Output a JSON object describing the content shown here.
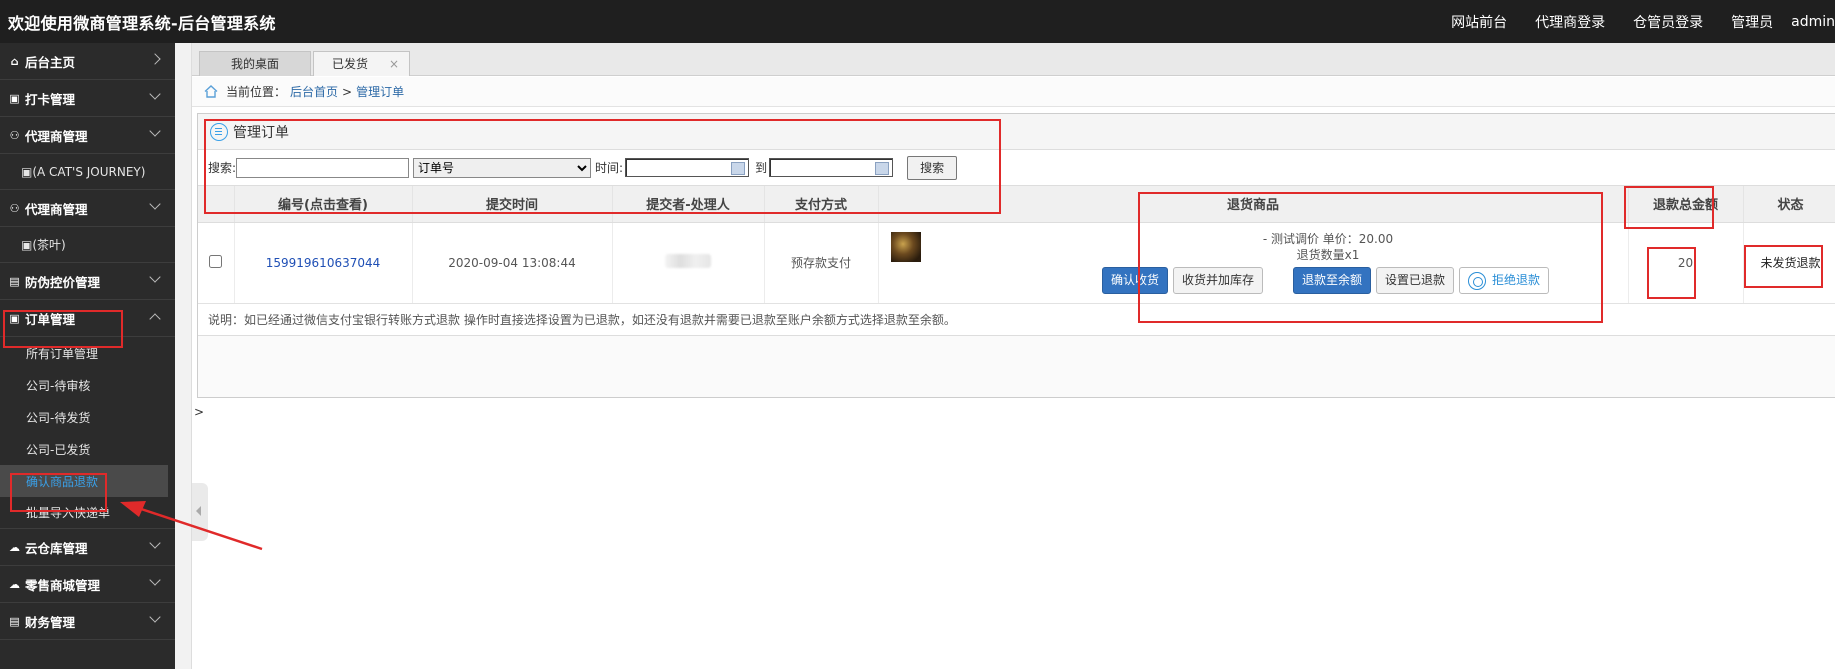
{
  "topbar": {
    "title": "欢迎使用微商管理系统-后台管理系统",
    "links": [
      "网站前台",
      "代理商登录",
      "仓管员登录",
      "管理员"
    ],
    "admin": "admin"
  },
  "sidebar": {
    "items": [
      {
        "label": "后台主页",
        "icon": "home-icon",
        "chevron": "right"
      },
      {
        "label": "打卡管理",
        "icon": "lock-icon",
        "chevron": "down"
      },
      {
        "label": "代理商管理",
        "icon": "user-icon",
        "chevron": "down"
      },
      {
        "label": "(A CAT'S JOURNEY)",
        "icon": "id-icon",
        "sub": true
      },
      {
        "label": "代理商管理",
        "icon": "user-icon",
        "chevron": "down"
      },
      {
        "label": "(茶叶)",
        "icon": "id-icon",
        "sub": true
      },
      {
        "label": "防伪控价管理",
        "icon": "shield-icon",
        "chevron": "down"
      },
      {
        "label": "订单管理",
        "icon": "lock-icon",
        "chevron": "up"
      }
    ],
    "order_subitems": [
      "所有订单管理",
      "公司-待审核",
      "公司-待发货",
      "公司-已发货",
      "确认商品退款",
      "批量导入快递单"
    ],
    "bottom_items": [
      {
        "label": "云仓库管理",
        "icon": "cloud-icon"
      },
      {
        "label": "零售商城管理",
        "icon": "cloud-icon"
      },
      {
        "label": "财务管理",
        "icon": "finance-icon"
      }
    ]
  },
  "tabs": [
    {
      "label": "我的桌面"
    },
    {
      "label": "已发货",
      "close": "×"
    }
  ],
  "breadcrumb": {
    "prefix": "当前位置：",
    "home": "后台首页",
    "sep": ">",
    "current": "管理订单"
  },
  "panel": {
    "title": "管理订单",
    "search_label": "搜索:",
    "select_value": "订单号",
    "time_label": "时间:",
    "to_label": "到",
    "search_button": "搜索"
  },
  "table": {
    "headers": [
      "编号(点击查看)",
      "提交时间",
      "提交者-处理人",
      "支付方式",
      "退货商品",
      "退款总金额",
      "状态"
    ],
    "row": {
      "order_no": "159919610637044",
      "time": "2020-09-04 13:08:44",
      "payment": "预存款支付",
      "product_line1": "- 测试调价 单价：20.00",
      "product_line2": "退货数量x1",
      "buttons": [
        "确认收货",
        "收货并加库存",
        "退款至余额",
        "设置已退款",
        "拒绝退款"
      ],
      "amount": "20",
      "status": "未发货退款"
    },
    "notice": "说明：如已经通过微信支付宝银行转账方式退款 操作时直接选择设置为已退款，如还没有退款并需要已退款至账户余额方式选择退款至余额。"
  },
  "gutter_arrow": ">"
}
